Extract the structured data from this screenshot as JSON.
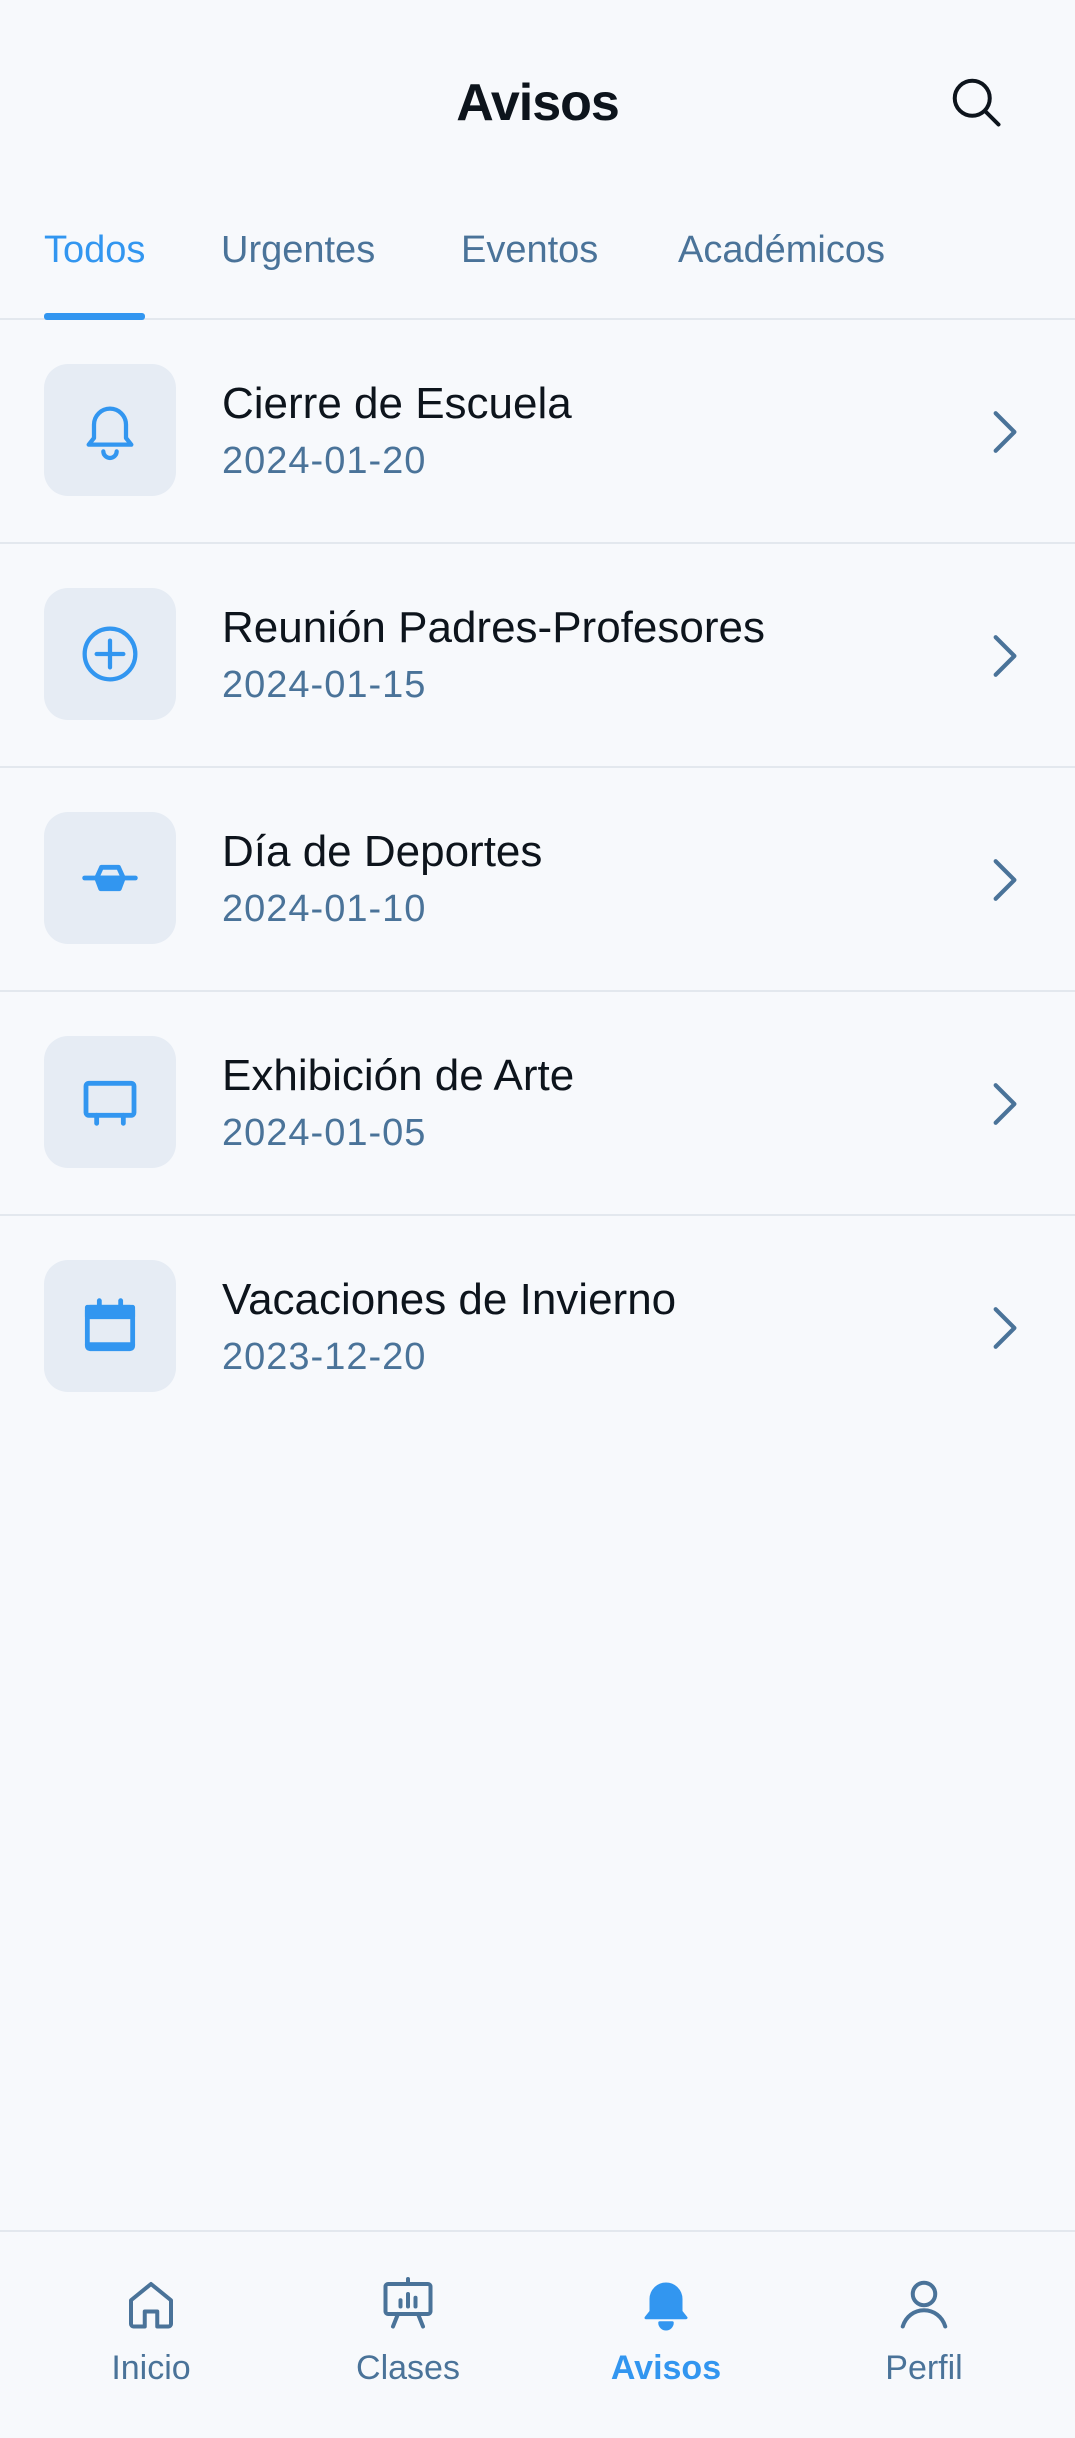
{
  "header": {
    "title": "Avisos",
    "search_icon": "search-icon"
  },
  "tabs": [
    {
      "label": "Todos",
      "active": true
    },
    {
      "label": "Urgentes",
      "active": false
    },
    {
      "label": "Eventos",
      "active": false
    },
    {
      "label": "Académicos",
      "active": false
    }
  ],
  "notices": [
    {
      "title": "Cierre de Escuela",
      "date": "2024-01-20",
      "icon": "bell-icon"
    },
    {
      "title": "Reunión Padres-Profesores",
      "date": "2024-01-15",
      "icon": "plus-circle-icon"
    },
    {
      "title": "Día de Deportes",
      "date": "2024-01-10",
      "icon": "sports-icon"
    },
    {
      "title": "Exhibición de Arte",
      "date": "2024-01-05",
      "icon": "easel-icon"
    },
    {
      "title": "Vacaciones de Invierno",
      "date": "2023-12-20",
      "icon": "calendar-icon"
    }
  ],
  "bottom_nav": [
    {
      "label": "Inicio",
      "icon": "home-icon",
      "active": false
    },
    {
      "label": "Clases",
      "icon": "presentation-icon",
      "active": false
    },
    {
      "label": "Avisos",
      "icon": "bell-icon",
      "active": true
    },
    {
      "label": "Perfil",
      "icon": "user-icon",
      "active": false
    }
  ],
  "colors": {
    "background": "#f7f9fc",
    "accent": "#3296f0",
    "secondary_text": "#4a7399",
    "icon_tile": "#e6ecf4",
    "divider": "#e3e8ee"
  }
}
